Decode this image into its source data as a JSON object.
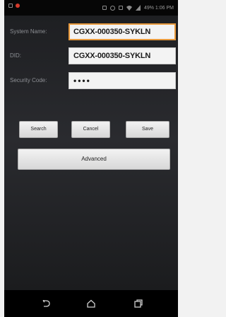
{
  "status_bar": {
    "text": "49% 1:06 PM"
  },
  "form": {
    "system_name": {
      "label": "System Name:",
      "value": "CGXX-000350-SYKLN"
    },
    "did": {
      "label": "DID:",
      "value": "CGXX-000350-SYKLN"
    },
    "security_code": {
      "label": "Security Code:",
      "value": "••••"
    }
  },
  "buttons": {
    "search": "Search",
    "cancel": "Cancel",
    "save": "Save",
    "advanced": "Advanced"
  },
  "colors": {
    "accent_border": "#e99a3d",
    "background": "#1e1f22"
  },
  "nav_icons": [
    "back-icon",
    "home-icon",
    "recents-icon"
  ]
}
